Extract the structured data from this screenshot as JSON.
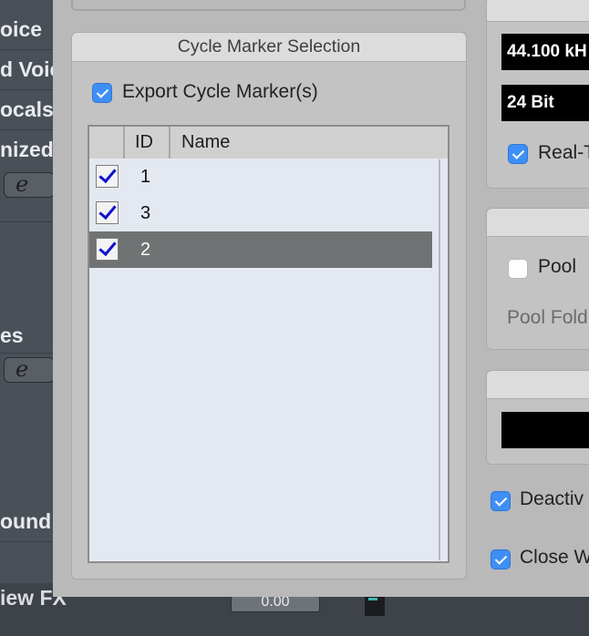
{
  "background": {
    "tracks": [
      "oice",
      "d Voic",
      "ocals",
      "nized",
      "es",
      "ound"
    ],
    "edit_glyph": "e",
    "view_fx_label": "iew FX",
    "value_box": "0.00"
  },
  "dialog": {
    "cycle_group": {
      "title": "Cycle Marker Selection",
      "export_label": "Export Cycle Marker(s)",
      "export_checked": true,
      "columns": [
        "ID",
        "Name"
      ],
      "rows": [
        {
          "id": "1",
          "name": "",
          "checked": true,
          "selected": false
        },
        {
          "id": "3",
          "name": "",
          "checked": true,
          "selected": false
        },
        {
          "id": "2",
          "name": "",
          "checked": true,
          "selected": true
        }
      ]
    },
    "right": {
      "sample_rate": "44.100 kH",
      "bit_depth": "24 Bit",
      "realtime_label": "Real-T",
      "pool_label": "Pool",
      "pool_folder_label": "Pool Fold",
      "deactivate_label": "Deactiv",
      "close_label": "Close W"
    }
  },
  "colors": {
    "checkbox_accent": "#3e8ff5",
    "selection": "#707373",
    "dialog_bg": "#b9b9b9"
  }
}
